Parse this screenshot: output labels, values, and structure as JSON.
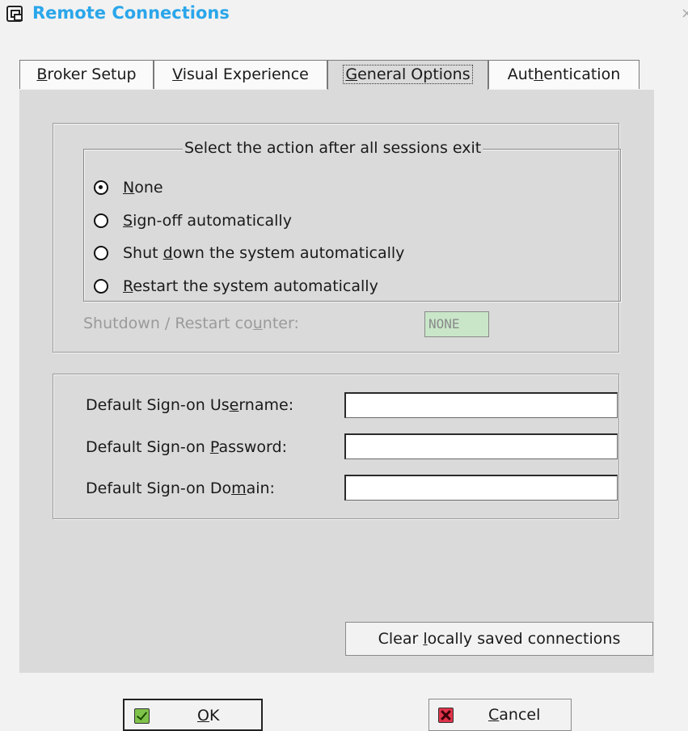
{
  "window": {
    "title": "Remote Connections",
    "close_glyph": "×"
  },
  "tabs": [
    {
      "pre": "",
      "ul": "B",
      "post": "roker Setup"
    },
    {
      "pre": "",
      "ul": "V",
      "post": "isual Experience"
    },
    {
      "pre": "",
      "ul": "G",
      "post": "eneral Options"
    },
    {
      "pre": "Aut",
      "ul": "h",
      "post": "entication"
    }
  ],
  "active_tab": "General Options",
  "session_exit": {
    "legend": "Select the action after all sessions exit",
    "options": [
      {
        "pre": "",
        "ul": "N",
        "post": "one",
        "checked": true
      },
      {
        "pre": "",
        "ul": "S",
        "post": "ign-off automatically",
        "checked": false
      },
      {
        "pre": "Shut ",
        "ul": "d",
        "post": "own the system automatically",
        "checked": false
      },
      {
        "pre": "",
        "ul": "R",
        "post": "estart the system automatically",
        "checked": false
      }
    ]
  },
  "counter": {
    "label_pre": "Shutdown / Restart co",
    "label_ul": "u",
    "label_post": "nter:",
    "value": "NONE"
  },
  "signon": {
    "username": {
      "pre": "Default Sign-on Us",
      "ul": "e",
      "post": "rname:",
      "value": ""
    },
    "password": {
      "pre": "Default Sign-on ",
      "ul": "P",
      "post": "assword:",
      "value": ""
    },
    "domain": {
      "pre": "Default Sign-on Do",
      "ul": "m",
      "post": "ain:",
      "value": ""
    }
  },
  "clear_button": {
    "pre": "Clear ",
    "ul": "l",
    "post": "ocally saved connections"
  },
  "ok_button": {
    "ul": "O",
    "post": "K"
  },
  "cancel_button": {
    "ul": "C",
    "post": "ancel"
  },
  "icons": {
    "app": "remote-connections-icon",
    "ok": "green-check-icon",
    "cancel": "red-x-icon"
  },
  "colors": {
    "title": "#2aa6ea",
    "panel": "#dadada",
    "counter_field": "#c9e6c9"
  }
}
